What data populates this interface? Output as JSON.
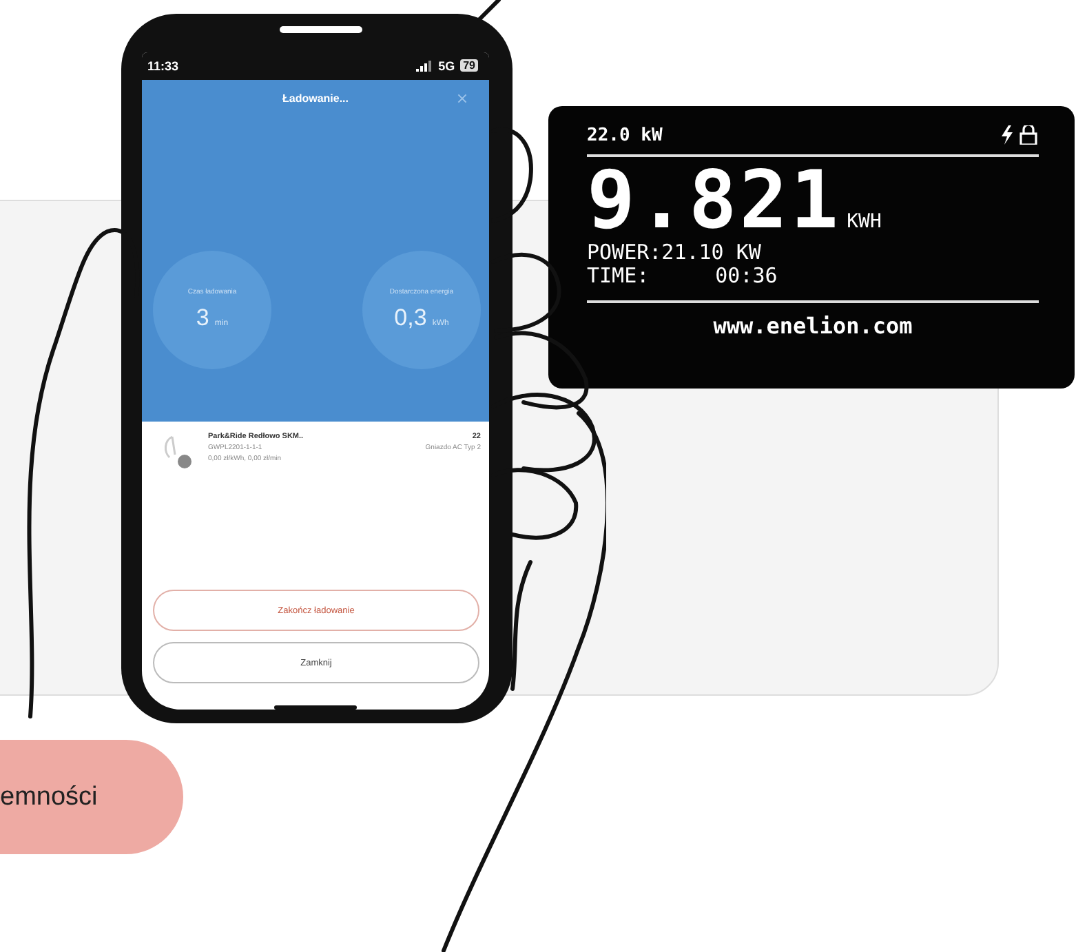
{
  "phone": {
    "status_bar": {
      "time": "11:33",
      "network": "5G",
      "battery": "79"
    },
    "title": "Ładowanie...",
    "stats": [
      {
        "label": "Czas ładowania",
        "value": "3",
        "unit": "min"
      },
      {
        "label": "Dostarczona energia",
        "value": "0,3",
        "unit": "kWh"
      }
    ],
    "station": {
      "name": "Park&Ride Redłowo SKM..",
      "id": "GWPL2201-1-1-1",
      "price": "0,00 zł/kWh, 0,00 zł/min",
      "power": "22",
      "connector": "Gniazdo AC Typ 2"
    },
    "buttons": [
      {
        "label": "Zakończ ładowanie",
        "kind": "danger"
      },
      {
        "label": "Zamknij",
        "kind": "plain"
      }
    ]
  },
  "charger_display": {
    "rated_power": "22.0 kW",
    "energy": "9.821",
    "energy_unit": "KWH",
    "power": "POWER:21.10 KW",
    "time_label": "TIME:",
    "time": "00:36",
    "url": "www.enelion.com"
  },
  "cta_button": {
    "label": "emności"
  }
}
